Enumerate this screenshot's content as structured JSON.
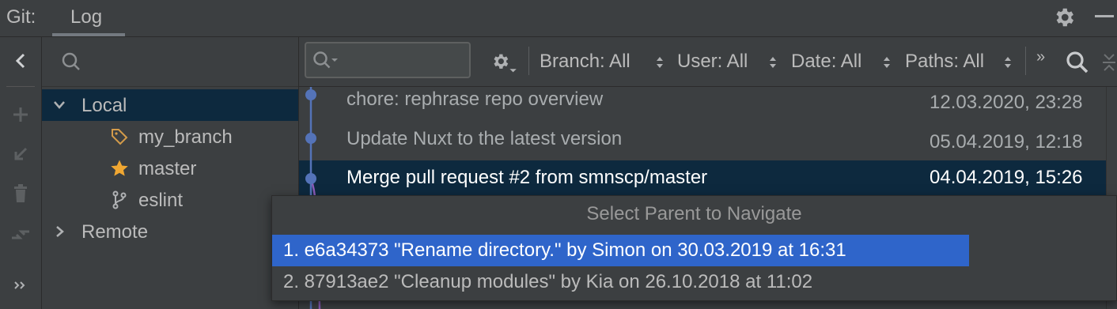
{
  "header": {
    "tool_label": "Git:",
    "tabs": [
      {
        "label": "Log"
      }
    ]
  },
  "branches": {
    "search_placeholder": "",
    "tree": {
      "local_label": "Local",
      "local_items": [
        {
          "label": "my_branch",
          "icon": "tag-icon",
          "color": "#d39b4a"
        },
        {
          "label": "master",
          "icon": "star-icon",
          "color": "#f0a732"
        },
        {
          "label": "eslint",
          "icon": "branch-icon",
          "color": "#afb1b3"
        }
      ],
      "remote_label": "Remote"
    }
  },
  "filters": {
    "search_placeholder": "",
    "items": [
      {
        "label": "Branch: All"
      },
      {
        "label": "User: All"
      },
      {
        "label": "Date: All"
      },
      {
        "label": "Paths: All"
      }
    ],
    "more": "»"
  },
  "commits": [
    {
      "message": "chore: rephrase repo overview",
      "date": "12.03.2020, 23:28",
      "selected": false
    },
    {
      "message": "Update Nuxt to the latest version",
      "date": "05.04.2019, 12:18",
      "selected": false
    },
    {
      "message": "Merge pull request #2 from smnscp/master",
      "date": "04.04.2019, 15:26",
      "selected": true
    }
  ],
  "popup": {
    "title": "Select Parent to Navigate",
    "items": [
      {
        "label": "1. e6a34373 \"Rename directory.\" by Simon on 30.03.2019 at 16:31",
        "selected": true
      },
      {
        "label": "2. 87913ae2 \"Cleanup modules\" by Kia on 26.10.2018 at 11:02",
        "selected": false
      }
    ]
  },
  "colors": {
    "selection": "#0d293e",
    "popup_selection": "#2f65ca",
    "graph_blue": "#5473b8",
    "graph_purple": "#8a5cb8"
  }
}
